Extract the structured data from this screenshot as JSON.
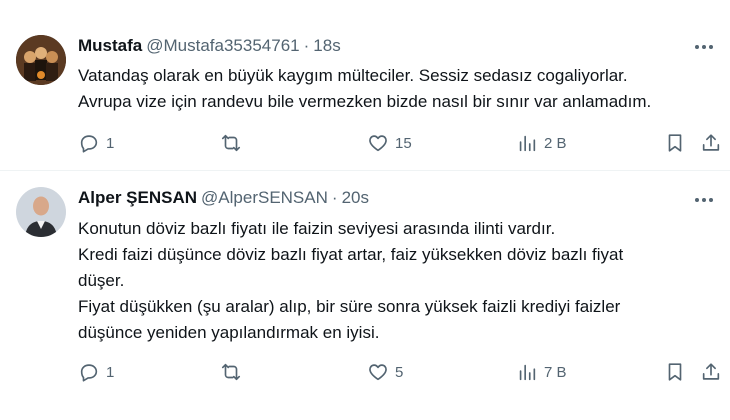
{
  "tweets": [
    {
      "name": "Mustafa",
      "handle": "@Mustafa35354761",
      "separator": "·",
      "time": "18s",
      "lines": [
        "Vatandaş olarak en büyük kaygım mülteciler. Sessiz sedasız cogaliyorlar.",
        "Avrupa vize için randevu bile vermezken bizde nasıl bir sınır var anlamadım."
      ],
      "replies": "1",
      "retweets": "",
      "likes": "15",
      "views": "2 B"
    },
    {
      "name": "Alper ŞENSAN",
      "handle": "@AlperSENSAN",
      "separator": "·",
      "time": "20s",
      "lines": [
        "Konutun döviz bazlı fiyatı ile faizin seviyesi arasında ilinti vardır.",
        "Kredi faizi düşünce döviz bazlı fiyat artar, faiz yüksekken döviz bazlı fiyat",
        "düşer.",
        "Fiyat düşükken (şu aralar) alıp, bir süre sonra yüksek faizli krediyi faizler",
        "düşünce yeniden yapılandırmak en iyisi."
      ],
      "replies": "1",
      "retweets": "",
      "likes": "5",
      "views": "7 B"
    }
  ],
  "icons": {
    "reply": "reply-icon",
    "retweet": "retweet-icon",
    "like": "heart-icon",
    "views": "views-chart-icon",
    "bookmark": "bookmark-icon",
    "share": "share-icon",
    "more": "more-icon"
  },
  "colors": {
    "text": "#0f1419",
    "secondary": "#536471",
    "divider": "#eff3f4"
  }
}
